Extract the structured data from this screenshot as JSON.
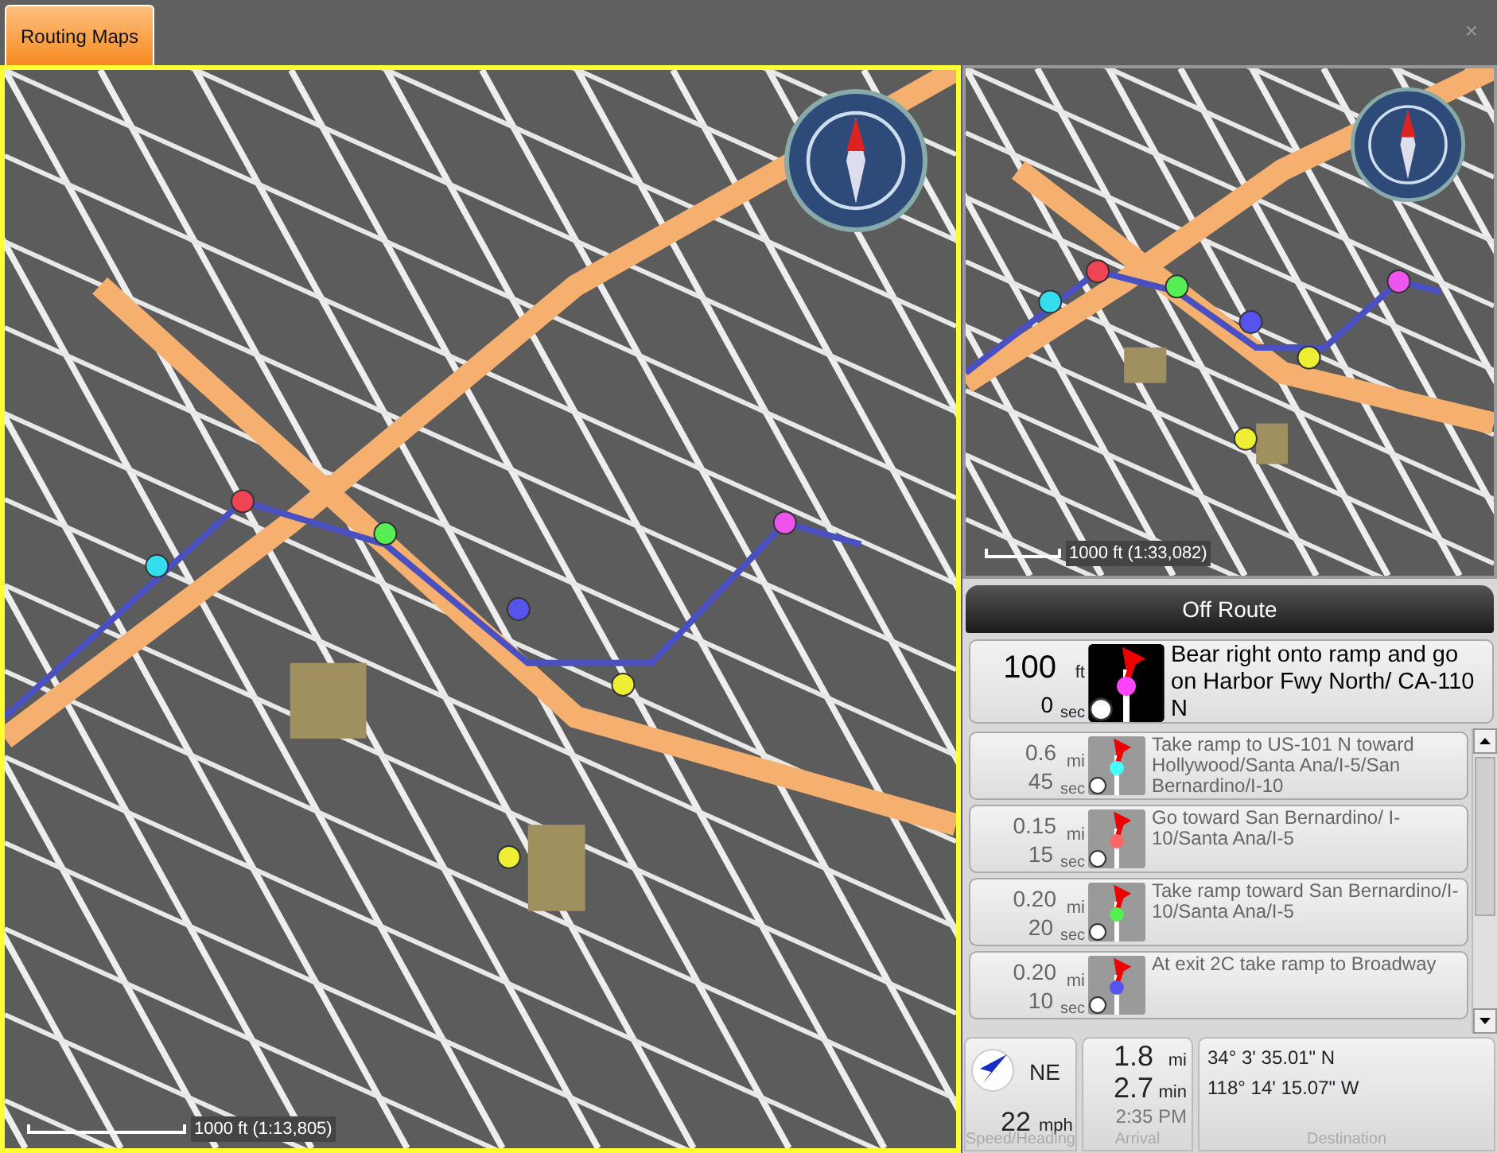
{
  "tabs": [
    {
      "label": "Routing Maps",
      "selected": true
    }
  ],
  "close_button": "×",
  "main_map": {
    "scale": "1000 ft (1:13,805)"
  },
  "overview_map": {
    "scale": "1000 ft (1:33,082)"
  },
  "route_status": "Off Route",
  "directions": [
    {
      "distance": "100",
      "unit": "ft",
      "time": "0",
      "time_unit": "sec",
      "instruction": "Bear right onto ramp and go on Harbor Fwy North/ CA-110 N",
      "current": true,
      "color": "#ff44ff"
    },
    {
      "distance": "0.6",
      "unit": "mi",
      "time": "45",
      "time_unit": "sec",
      "instruction": "Take ramp to US-101 N toward Hollywood/Santa Ana/I-5/San Bernardino/I-10",
      "current": false,
      "color": "#44ffff"
    },
    {
      "distance": "0.15",
      "unit": "mi",
      "time": "15",
      "time_unit": "sec",
      "instruction": "Go toward San Bernardino/ I-10/Santa Ana/I-5",
      "current": false,
      "color": "#ff6666"
    },
    {
      "distance": "0.20",
      "unit": "mi",
      "time": "20",
      "time_unit": "sec",
      "instruction": "Take ramp toward San Bernardino/I-10/Santa Ana/I-5",
      "current": false,
      "color": "#55ee55"
    },
    {
      "distance": "0.20",
      "unit": "mi",
      "time": "10",
      "time_unit": "sec",
      "instruction": "At exit 2C take ramp to Broadway",
      "current": false,
      "color": "#5555ee"
    }
  ],
  "speed_heading": {
    "heading": "NE",
    "speed": "22",
    "speed_unit": "mph",
    "caption": "Speed/Heading"
  },
  "arrival": {
    "distance": "1.8",
    "distance_unit": "mi",
    "time": "2.7",
    "time_unit": "min",
    "clock": "2:35 PM",
    "caption": "Arrival"
  },
  "destination": {
    "latitude": "34° 3' 35.01\" N",
    "longitude": "118° 14' 15.07\" W",
    "caption": "Destination"
  }
}
